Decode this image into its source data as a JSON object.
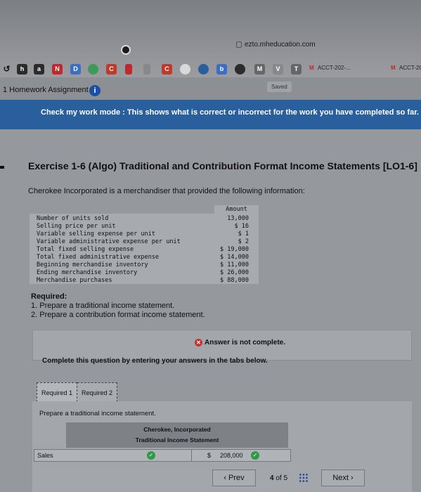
{
  "browser": {
    "url": "ezto.mheducation.com",
    "tabs": [
      {
        "icon": "h-icon",
        "letter": "h",
        "color": "#2b2b2b"
      },
      {
        "icon": "amazon-icon",
        "letter": "a",
        "color": "#2b2b2b"
      },
      {
        "icon": "n-icon",
        "letter": "N",
        "color": "#c0282d"
      },
      {
        "icon": "d-icon",
        "letter": "D",
        "color": "#3b6fc4"
      },
      {
        "icon": "circle-green-icon",
        "letter": "",
        "color": "#3e9a5a"
      },
      {
        "icon": "c-icon",
        "letter": "C",
        "color": "#c03a2b"
      },
      {
        "icon": "flag-icon",
        "letter": "",
        "color": "#c0282d"
      },
      {
        "icon": "pen-icon",
        "letter": "",
        "color": "#888888"
      },
      {
        "icon": "c2-icon",
        "letter": "C",
        "color": "#c03a2b"
      },
      {
        "icon": "heart-icon",
        "letter": "",
        "color": "#d9d9d9"
      },
      {
        "icon": "target-icon",
        "letter": "",
        "color": "#2a5f9e"
      },
      {
        "icon": "b-icon",
        "letter": "b",
        "color": "#3b6fc4"
      },
      {
        "icon": "circle-dark-icon",
        "letter": "",
        "color": "#2b2b2b"
      },
      {
        "icon": "m-icon",
        "letter": "M",
        "color": "#666666"
      },
      {
        "icon": "v-icon",
        "letter": "V",
        "color": "#888888"
      },
      {
        "icon": "t-icon",
        "letter": "T",
        "color": "#666666"
      }
    ],
    "tab_titles": [
      "ACCT-202-...",
      "ACCT-20"
    ],
    "gmail_glyph": "M"
  },
  "header": {
    "assignment": "1 Homework Assignment",
    "saved": "Saved"
  },
  "banner": {
    "text": "Check my work mode : This shows what is correct or incorrect for the work you have completed so far. I"
  },
  "exercise": {
    "title": "Exercise 1-6 (Algo) Traditional and Contribution Format Income Statements [LO1-6]",
    "intro": "Cherokee Incorporated is a merchandiser that provided the following information:",
    "table_header": "Amount",
    "rows": [
      {
        "label": "Number of units sold",
        "value": "13,000"
      },
      {
        "label": "Selling price per unit",
        "value": "$ 16"
      },
      {
        "label": "Variable selling expense per unit",
        "value": "$ 1"
      },
      {
        "label": "Variable administrative expense per unit",
        "value": "$ 2"
      },
      {
        "label": "Total fixed selling expense",
        "value": "$ 19,000"
      },
      {
        "label": "Total fixed administrative expense",
        "value": "$ 14,000"
      },
      {
        "label": "Beginning merchandise inventory",
        "value": "$ 11,000"
      },
      {
        "label": "Ending merchandise inventory",
        "value": "$ 26,000"
      },
      {
        "label": "Merchandise purchases",
        "value": "$ 88,000"
      }
    ],
    "required_heading": "Required:",
    "required_1": "1. Prepare a traditional income statement.",
    "required_2": "2. Prepare a contribution format income statement."
  },
  "answer": {
    "status": "Answer is not complete.",
    "instruction": "Complete this question by entering your answers in the tabs below."
  },
  "req_tabs": [
    "Required 1",
    "Required 2"
  ],
  "statement": {
    "prepare": "Prepare a traditional income statement.",
    "company": "Cherokee, Incorporated",
    "title": "Traditional Income Statement",
    "row_label": "Sales",
    "currency": "$",
    "row_value": "208,000"
  },
  "nav": {
    "prev": "Prev",
    "page_current": "4",
    "page_of": "of 5",
    "next": "Next"
  },
  "colors": {
    "banner": "#2a5f9e",
    "correct": "#2e9a48",
    "incorrect": "#c8322e"
  }
}
